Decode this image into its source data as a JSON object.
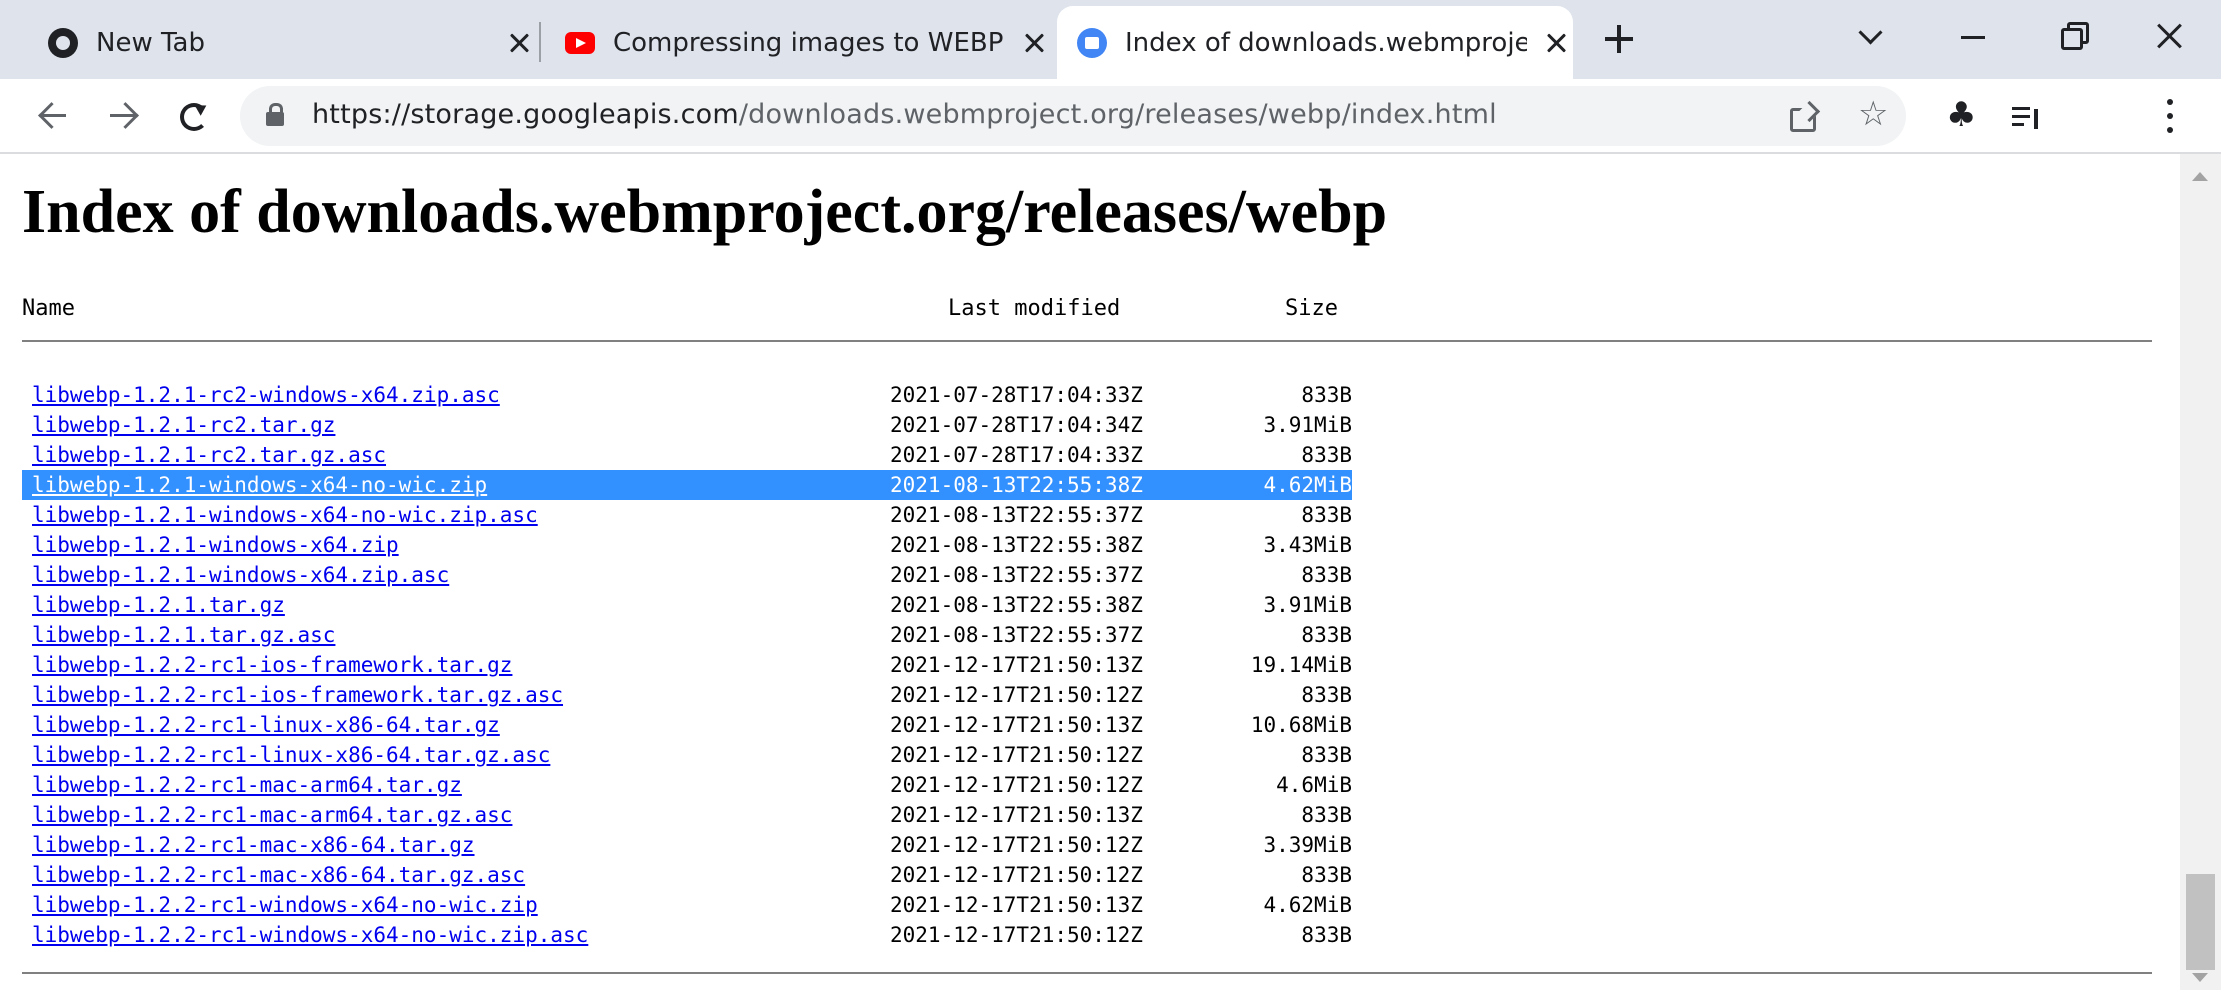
{
  "browser": {
    "tabs": [
      {
        "title": "New Tab",
        "icon": "chrome-icon",
        "active": false
      },
      {
        "title": "Compressing images to WEBP on",
        "icon": "youtube-icon",
        "active": false
      },
      {
        "title": "Index of downloads.webmproject",
        "icon": "cloud-storage-icon",
        "active": true
      }
    ],
    "url_host": "https://storage.googleapis.com",
    "url_path": "/downloads.webmproject.org/releases/webp/index.html"
  },
  "page": {
    "title": "Index of downloads.webmproject.org/releases/webp",
    "columns": {
      "name": "Name",
      "modified": "Last modified",
      "size": "Size"
    },
    "rows": [
      {
        "name": "libwebp-1.2.1-rc2-windows-x64.zip.asc",
        "modified": "2021-07-28T17:04:33Z",
        "size": "833B"
      },
      {
        "name": "libwebp-1.2.1-rc2.tar.gz",
        "modified": "2021-07-28T17:04:34Z",
        "size": "3.91MiB"
      },
      {
        "name": "libwebp-1.2.1-rc2.tar.gz.asc",
        "modified": "2021-07-28T17:04:33Z",
        "size": "833B"
      },
      {
        "name": "libwebp-1.2.1-windows-x64-no-wic.zip",
        "modified": "2021-08-13T22:55:38Z",
        "size": "4.62MiB",
        "selected": true
      },
      {
        "name": "libwebp-1.2.1-windows-x64-no-wic.zip.asc",
        "modified": "2021-08-13T22:55:37Z",
        "size": "833B"
      },
      {
        "name": "libwebp-1.2.1-windows-x64.zip",
        "modified": "2021-08-13T22:55:38Z",
        "size": "3.43MiB"
      },
      {
        "name": "libwebp-1.2.1-windows-x64.zip.asc",
        "modified": "2021-08-13T22:55:37Z",
        "size": "833B"
      },
      {
        "name": "libwebp-1.2.1.tar.gz",
        "modified": "2021-08-13T22:55:38Z",
        "size": "3.91MiB"
      },
      {
        "name": "libwebp-1.2.1.tar.gz.asc",
        "modified": "2021-08-13T22:55:37Z",
        "size": "833B"
      },
      {
        "name": "libwebp-1.2.2-rc1-ios-framework.tar.gz",
        "modified": "2021-12-17T21:50:13Z",
        "size": "19.14MiB"
      },
      {
        "name": "libwebp-1.2.2-rc1-ios-framework.tar.gz.asc",
        "modified": "2021-12-17T21:50:12Z",
        "size": "833B"
      },
      {
        "name": "libwebp-1.2.2-rc1-linux-x86-64.tar.gz",
        "modified": "2021-12-17T21:50:13Z",
        "size": "10.68MiB"
      },
      {
        "name": "libwebp-1.2.2-rc1-linux-x86-64.tar.gz.asc",
        "modified": "2021-12-17T21:50:12Z",
        "size": "833B"
      },
      {
        "name": "libwebp-1.2.2-rc1-mac-arm64.tar.gz",
        "modified": "2021-12-17T21:50:12Z",
        "size": "4.6MiB"
      },
      {
        "name": "libwebp-1.2.2-rc1-mac-arm64.tar.gz.asc",
        "modified": "2021-12-17T21:50:13Z",
        "size": "833B"
      },
      {
        "name": "libwebp-1.2.2-rc1-mac-x86-64.tar.gz",
        "modified": "2021-12-17T21:50:12Z",
        "size": "3.39MiB"
      },
      {
        "name": "libwebp-1.2.2-rc1-mac-x86-64.tar.gz.asc",
        "modified": "2021-12-17T21:50:12Z",
        "size": "833B"
      },
      {
        "name": "libwebp-1.2.2-rc1-windows-x64-no-wic.zip",
        "modified": "2021-12-17T21:50:13Z",
        "size": "4.62MiB"
      },
      {
        "name": "libwebp-1.2.2-rc1-windows-x64-no-wic.zip.asc",
        "modified": "2021-12-17T21:50:12Z",
        "size": "833B"
      }
    ]
  },
  "colors": {
    "tab_strip": "#dee3ec",
    "link": "#0000ee",
    "selection": "#3390ff"
  }
}
